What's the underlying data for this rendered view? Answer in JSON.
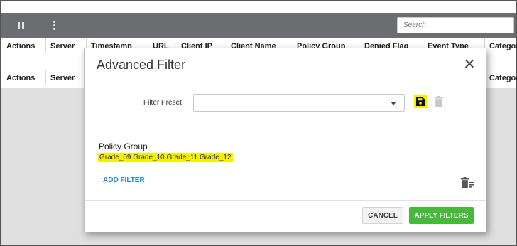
{
  "toolbar": {
    "search_placeholder": "Search"
  },
  "table": {
    "columns": [
      "Actions",
      "Server",
      "Timestamp",
      "URL",
      "Client IP",
      "Client Name",
      "Policy Group",
      "Denied Flag",
      "Event Type",
      "Category"
    ]
  },
  "dialog": {
    "title": "Advanced Filter",
    "preset_label": "Filter Preset",
    "preset_value": "",
    "filter_name": "Policy Group",
    "filter_values": "Grade_09 Grade_10 Grade_11 Grade_12",
    "add_filter_label": "ADD FILTER",
    "cancel_label": "CANCEL",
    "apply_label": "APPLY FILTERS"
  },
  "colors": {
    "toolbar_bg": "#6b6d70",
    "highlight": "#f4f000",
    "link_blue": "#1e88d6",
    "apply_green": "#46b93a"
  },
  "icons": [
    "pause-icon",
    "more-vertical-icon",
    "close-icon",
    "dropdown-caret-icon",
    "save-icon",
    "trash-icon",
    "clear-filters-icon"
  ]
}
